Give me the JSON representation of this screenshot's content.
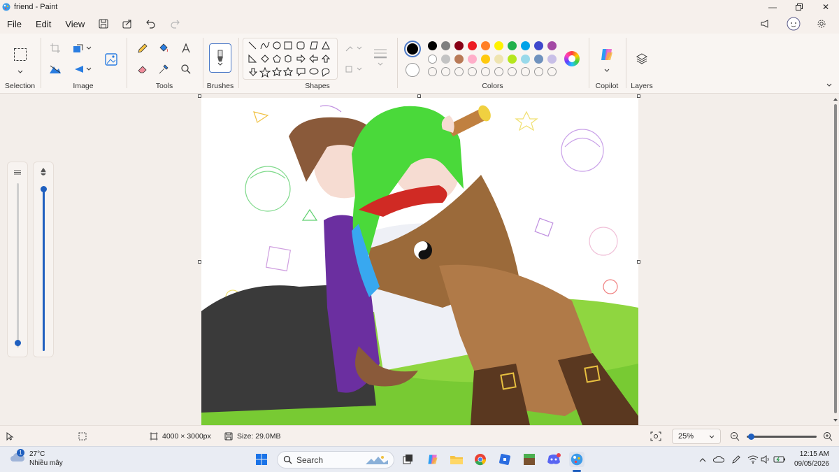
{
  "window": {
    "title": "friend - Paint"
  },
  "menu": {
    "file": "File",
    "edit": "Edit",
    "view": "View"
  },
  "ribbon": {
    "groups": {
      "selection": "Selection",
      "image": "Image",
      "tools": "Tools",
      "brushes": "Brushes",
      "shapes": "Shapes",
      "colors": "Colors",
      "copilot": "Copilot",
      "layers": "Layers"
    },
    "palette_row1": [
      "#000000",
      "#7f7f7f",
      "#880015",
      "#ed1c24",
      "#ff7f27",
      "#fff200",
      "#22b14c",
      "#00a2e8",
      "#3f48cc",
      "#a349a4"
    ],
    "palette_row2": [
      "#ffffff",
      "#c3c3c3",
      "#b97a57",
      "#ffaec9",
      "#ffc90e",
      "#efe4b0",
      "#b5e61d",
      "#99d9ea",
      "#7092be",
      "#c8bfe7"
    ],
    "primary_color": "#000000",
    "secondary_color": "#ffffff"
  },
  "status": {
    "dimensions": "4000 × 3000px",
    "size": "Size: 29.0MB",
    "zoom": "25%"
  },
  "taskbar": {
    "weather_temp": "27°C",
    "weather_desc": "Nhiều mây",
    "weather_badge": "1",
    "search_placeholder": "Search",
    "time": "12:15 AM",
    "date": "09/05/2026"
  }
}
